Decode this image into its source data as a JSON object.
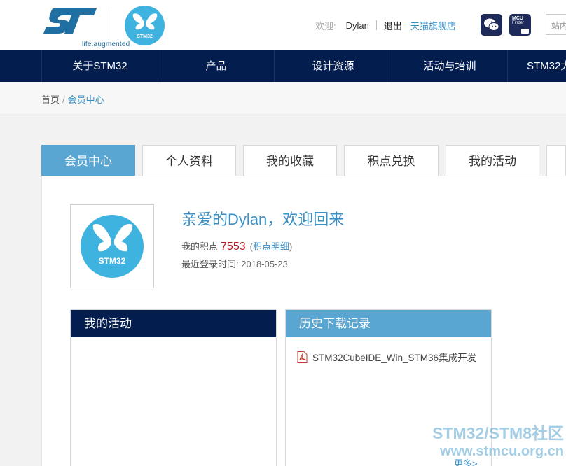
{
  "brand": {
    "tagline": "life.augmented",
    "stm_mark": "STM32"
  },
  "user_bar": {
    "welcome": "欢迎:",
    "username": "Dylan",
    "logout": "退出",
    "tmall_store": "天猫旗舰店",
    "search_placeholder": "站内"
  },
  "icons": {
    "mcu_finder_line1": "MCU",
    "mcu_finder_line2": "Finder"
  },
  "nav": {
    "items": [
      "关于STM32",
      "产品",
      "设计资源",
      "活动与培训",
      "STM32大"
    ]
  },
  "breadcrumb": {
    "home": "首页",
    "separator": "/",
    "current": "会员中心"
  },
  "tabs": [
    "会员中心",
    "个人资料",
    "我的收藏",
    "积点兑换",
    "我的活动"
  ],
  "profile": {
    "greeting": "亲爱的Dylan，欢迎回来",
    "points_label": "我的积点",
    "points_value": "7553",
    "paren_open": "(",
    "points_detail_link": "积点明细",
    "paren_close": ")",
    "last_login_label": "最近登录时间:",
    "last_login_date": "2018-05-23"
  },
  "activities_box": {
    "title": "我的活动"
  },
  "downloads_box": {
    "title": "历史下载记录",
    "items": [
      "STM32CubeIDE_Win_STM36集成开发"
    ],
    "more": "更多>"
  },
  "watermark": {
    "line1": "STM32/STM8社区",
    "line2": "www.stmcu.org.cn"
  },
  "colors": {
    "nav_bg": "#031d4f",
    "accent_blue": "#5aa6d2",
    "link_blue": "#3a8fc4",
    "points_red": "#b51d1d"
  }
}
